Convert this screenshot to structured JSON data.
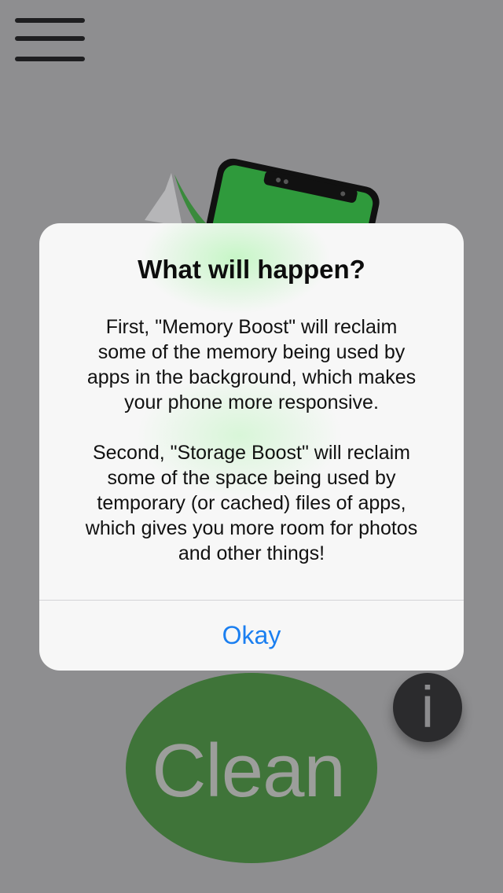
{
  "menu": {
    "icon": "hamburger-menu-icon"
  },
  "background": {
    "illustration": "phone-illustration"
  },
  "clean_button": {
    "label": "Clean",
    "color": "#3f7439"
  },
  "info_button": {
    "label": "i",
    "icon": "info-icon"
  },
  "alert": {
    "title": "What will happen?",
    "message": "First, \"Memory Boost\" will reclaim\nsome of the memory being used by\napps in the background, which makes\nyour phone more responsive.\n\nSecond, \"Storage Boost\" will reclaim\nsome of the space being used by\ntemporary (or cached) files of apps,\nwhich gives you more room for photos\nand other things!",
    "action_label": "Okay",
    "action_color": "#1b7ff0"
  }
}
